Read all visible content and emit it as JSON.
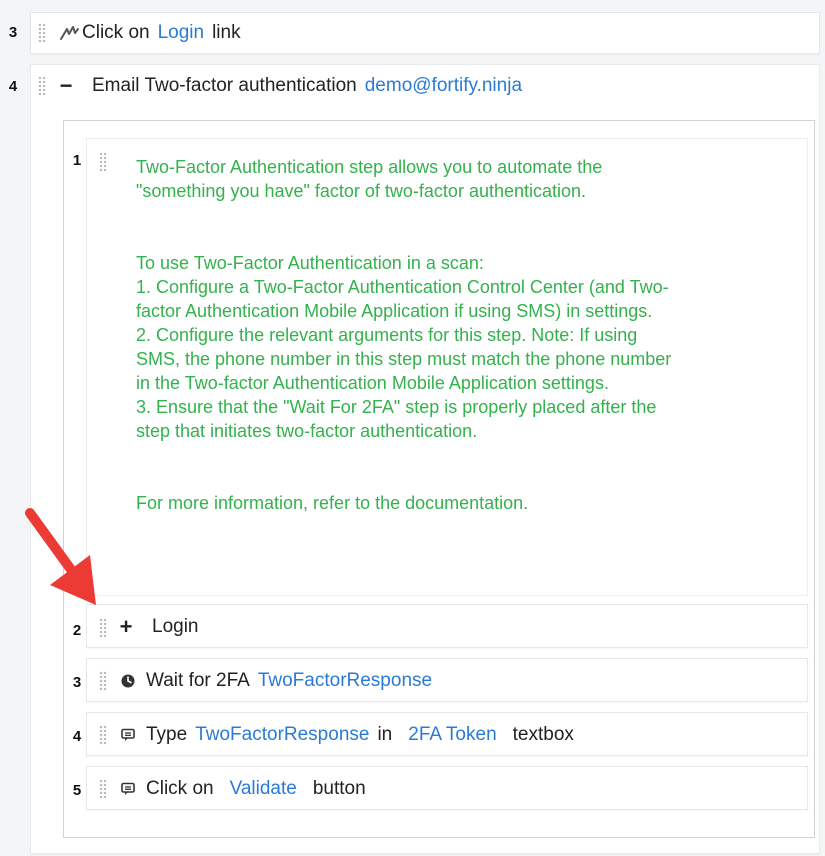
{
  "steps": {
    "step3": {
      "number": "3",
      "icon": "mouse-click-icon",
      "action": "Click on",
      "target": "Login",
      "suffix": "link"
    },
    "step4": {
      "number": "4",
      "toggle": "−",
      "title": "Email Two-factor authentication",
      "email": "demo@fortify.ninja"
    }
  },
  "substeps": {
    "comment": {
      "number": "1",
      "paragraph1": "Two-Factor Authentication step allows you to automate the \"something you have\" factor of two-factor authentication.",
      "paragraph2_lines": [
        "To use Two-Factor Authentication in a scan:",
        "1. Configure a Two-Factor Authentication Control Center (and Two-factor Authentication Mobile Application if using SMS) in settings.",
        "2. Configure the relevant arguments for this step. Note: If using SMS, the phone number in this step must match the phone number in the Two-factor Authentication Mobile Application settings.",
        "3. Ensure that the \"Wait For 2FA\" step is properly placed after the step that initiates two-factor authentication."
      ],
      "paragraph3": "For more information, refer to the documentation."
    },
    "login": {
      "number": "2",
      "toggle": "+",
      "label": "Login"
    },
    "wait": {
      "number": "3",
      "icon": "clock-icon",
      "action": "Wait for 2FA",
      "variable": "TwoFactorResponse"
    },
    "type": {
      "number": "4",
      "icon": "keyboard-icon",
      "action": "Type",
      "variable": "TwoFactorResponse",
      "in": "in",
      "target": "2FA Token",
      "suffix": "textbox"
    },
    "click": {
      "number": "5",
      "icon": "keyboard-icon",
      "action": "Click on",
      "target": "Validate",
      "suffix": "button"
    }
  },
  "colors": {
    "link": "#2b7bd6",
    "comment_text": "#33b24d",
    "arrow": "#ec3b35"
  }
}
